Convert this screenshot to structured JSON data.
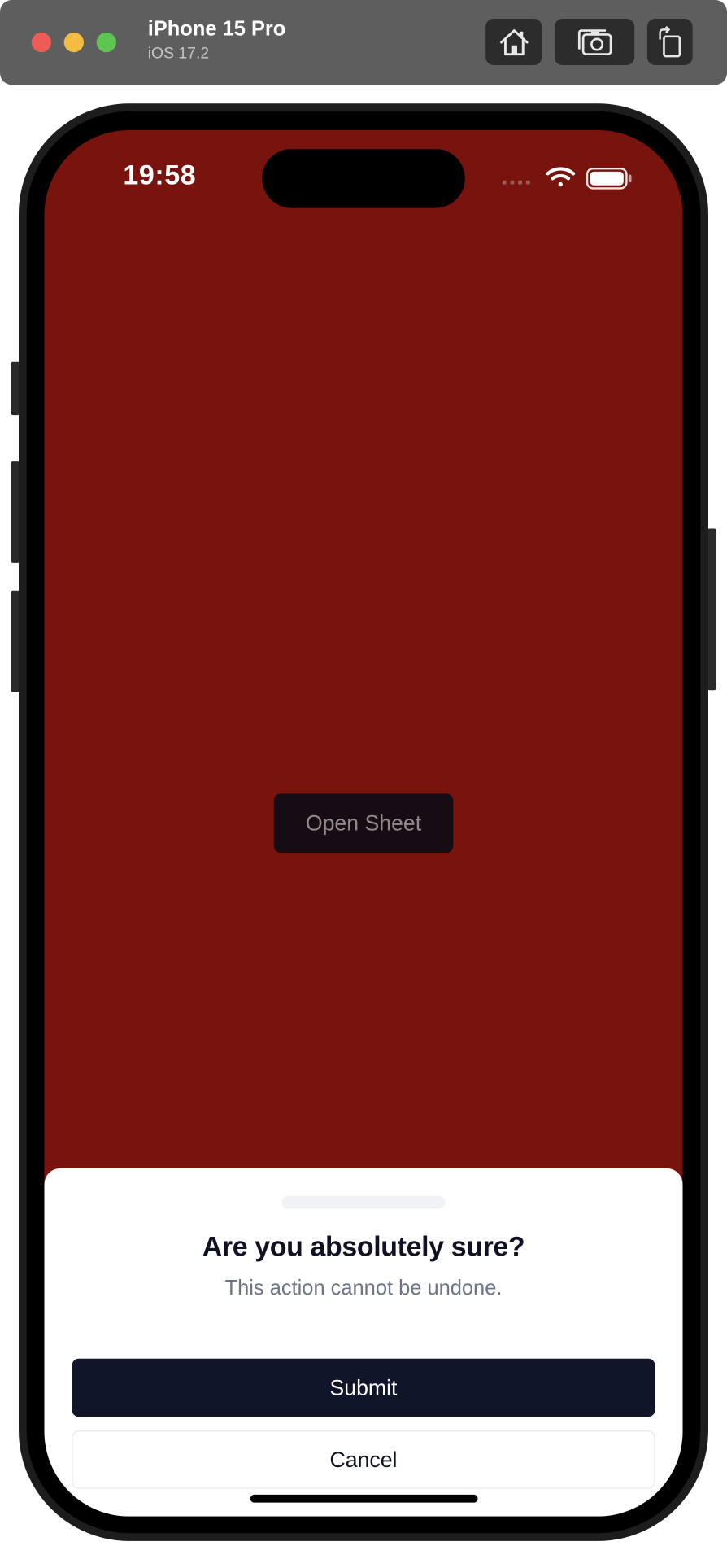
{
  "toolbar": {
    "device_name": "iPhone 15 Pro",
    "os_version": "iOS 17.2",
    "icons": [
      "home-icon",
      "screenshot-icon",
      "rotate-icon"
    ]
  },
  "status_bar": {
    "time": "19:58",
    "icons": [
      "cellular-signal-icon",
      "wifi-icon",
      "battery-icon"
    ]
  },
  "app": {
    "background_color": "#78130e",
    "open_sheet_label": "Open Sheet"
  },
  "sheet": {
    "title": "Are you absolutely sure?",
    "description": "This action cannot be undone.",
    "submit_label": "Submit",
    "cancel_label": "Cancel"
  }
}
